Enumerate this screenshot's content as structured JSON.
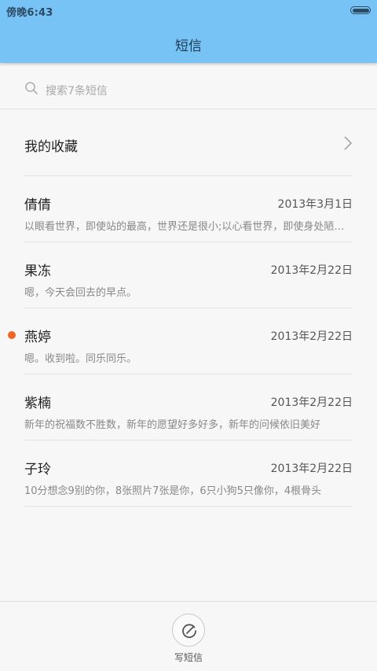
{
  "status_bar": {
    "time": "傍晚6:43",
    "battery_icon": "battery-icon"
  },
  "header": {
    "title": "短信"
  },
  "search": {
    "placeholder": "搜索7条短信",
    "icon": "search-icon"
  },
  "favorites": {
    "label": "我的收藏",
    "icon": "chevron-right-icon"
  },
  "conversations": [
    {
      "name": "倩倩",
      "date": "2013年3月1日",
      "preview": "以眼看世界，即使站的最高，世界还是很小;以心看世界，即使身处陋室，世界依然很大",
      "unread": false
    },
    {
      "name": "果冻",
      "date": "2013年2月22日",
      "preview": "嗯，今天会回去的早点。",
      "unread": false
    },
    {
      "name": "燕婷",
      "date": "2013年2月22日",
      "preview": "嗯。收到啦。同乐同乐。",
      "unread": true
    },
    {
      "name": "紫楠",
      "date": "2013年2月22日",
      "preview": "新年的祝福数不胜数，新年的愿望好多好多，新年的问候依旧美好",
      "unread": false
    },
    {
      "name": "子玲",
      "date": "2013年2月22日",
      "preview": "10分想念9别的你，8张照片7张是你，6只小狗5只像你，4根骨头",
      "unread": false
    }
  ],
  "bottom": {
    "compose_label": "写短信",
    "compose_icon": "compose-icon"
  },
  "colors": {
    "header": "#78c3f6",
    "unread_dot": "#f26522"
  }
}
